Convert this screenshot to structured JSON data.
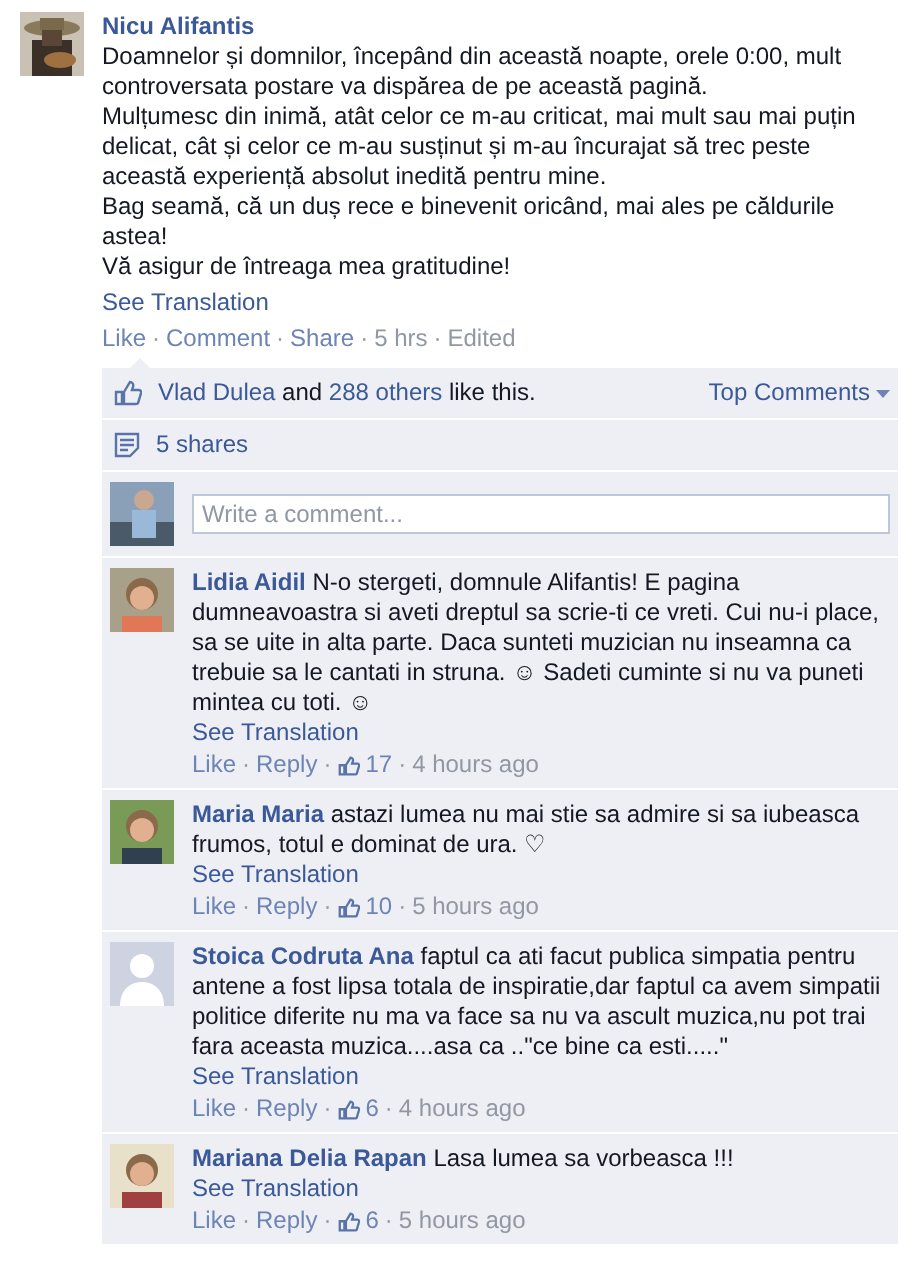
{
  "post": {
    "author": "Nicu Alifantis",
    "paragraphs": [
      "Doamnelor și domnilor, începând din această noapte, orele 0:00, mult controversata postare va dispărea de pe această pagină.",
      "Mulțumesc din inimă, atât celor ce m-au criticat, mai mult sau mai puțin delicat, cât și celor ce m-au susținut și m-au încurajat să trec peste această experiență absolut inedită pentru mine.",
      "Bag seamă, că un duș rece e binevenit oricând, mai ales pe căldurile astea!",
      "Vă asigur de întreaga mea gratitudine!"
    ],
    "translate": "See Translation",
    "actions": [
      "Like",
      "Comment",
      "Share"
    ],
    "separator": "·",
    "time": "5 hrs",
    "edited": "Edited"
  },
  "likes": {
    "name": "Vlad Dulea",
    "middle": "and",
    "others": "288 others",
    "tail": "like this.",
    "sort": "Top Comments"
  },
  "shares": "5 shares",
  "comment_field": {
    "placeholder": "Write a comment..."
  },
  "comments": [
    {
      "author": "Lidia Aidil",
      "text": "N-o stergeti, domnule Alifantis! E pagina dumneavoastra si aveti dreptul sa scrie-ti ce vreti. Cui nu-i place, sa se uite in alta parte. Daca sunteti muzician nu inseamna ca trebuie sa le cantati in struna. ☺ Sadeti cuminte si nu va puneti mintea cu toti. ☺",
      "translate": "See Translation",
      "like": "Like",
      "reply": "Reply",
      "count": "17",
      "time": "4 hours ago"
    },
    {
      "author": "Maria Maria",
      "text": "astazi lumea nu mai stie sa admire si sa iubeasca frumos, totul e dominat de ura. ♡",
      "translate": "See Translation",
      "like": "Like",
      "reply": "Reply",
      "count": "10",
      "time": "5 hours ago"
    },
    {
      "author": "Stoica Codruta Ana",
      "text": "faptul ca ati facut publica simpatia pentru antene a fost lipsa totala de inspiratie,dar faptul ca avem simpatii politice diferite nu ma va face sa nu va ascult muzica,nu pot trai fara aceasta muzica....asa ca ..\"ce bine ca esti.....\"",
      "translate": "See Translation",
      "like": "Like",
      "reply": "Reply",
      "count": "6",
      "time": "4 hours ago",
      "kind": "silhouette"
    },
    {
      "author": "Mariana Delia Rapan",
      "text": "Lasa lumea sa vorbeasca !!!",
      "translate": "See Translation",
      "like": "Like",
      "reply": "Reply",
      "count": "6",
      "time": "5 hours ago"
    }
  ]
}
